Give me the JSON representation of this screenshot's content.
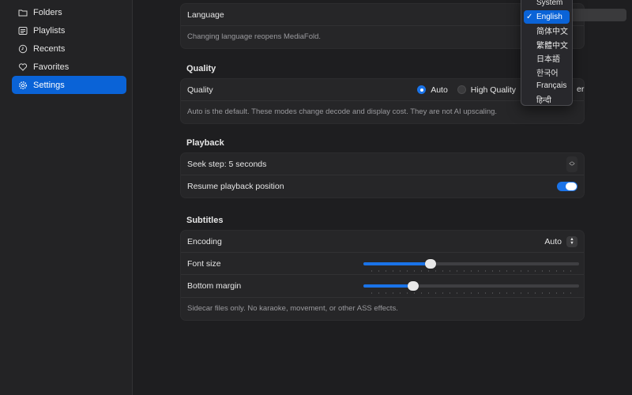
{
  "sidebar": {
    "items": [
      {
        "label": "Folders",
        "icon": "folder-icon"
      },
      {
        "label": "Playlists",
        "icon": "list-icon"
      },
      {
        "label": "Recents",
        "icon": "clock-icon"
      },
      {
        "label": "Favorites",
        "icon": "heart-icon"
      },
      {
        "label": "Settings",
        "icon": "gear-icon"
      }
    ],
    "active": "Settings"
  },
  "language": {
    "label": "Language",
    "note": "Changing language reopens MediaFold.",
    "menu": {
      "items": [
        "System",
        "English",
        "简体中文",
        "繁體中文",
        "日本語",
        "한국어",
        "Français",
        "हिन्दी"
      ],
      "selected": "English",
      "check": "✓"
    }
  },
  "quality": {
    "section_title": "Quality",
    "label": "Quality",
    "options": [
      "Auto",
      "High Quality"
    ],
    "selected": "Auto",
    "cut_text": "er",
    "note": "Auto is the default. These modes change decode and display cost. They are not AI upscaling."
  },
  "playback": {
    "section_title": "Playback",
    "seek_label": "Seek step: 5 seconds",
    "resume_label": "Resume playback position",
    "resume_on": true
  },
  "subtitles": {
    "section_title": "Subtitles",
    "encoding_label": "Encoding",
    "encoding_value": "Auto",
    "font_size_label": "Font size",
    "font_size_fraction": 0.31,
    "bottom_margin_label": "Bottom margin",
    "bottom_margin_fraction": 0.23,
    "note": "Sidecar files only. No karaoke, movement, or other ASS effects."
  },
  "colors": {
    "accent": "#0a63d7",
    "background": "#1e1e20",
    "group": "#262628"
  }
}
